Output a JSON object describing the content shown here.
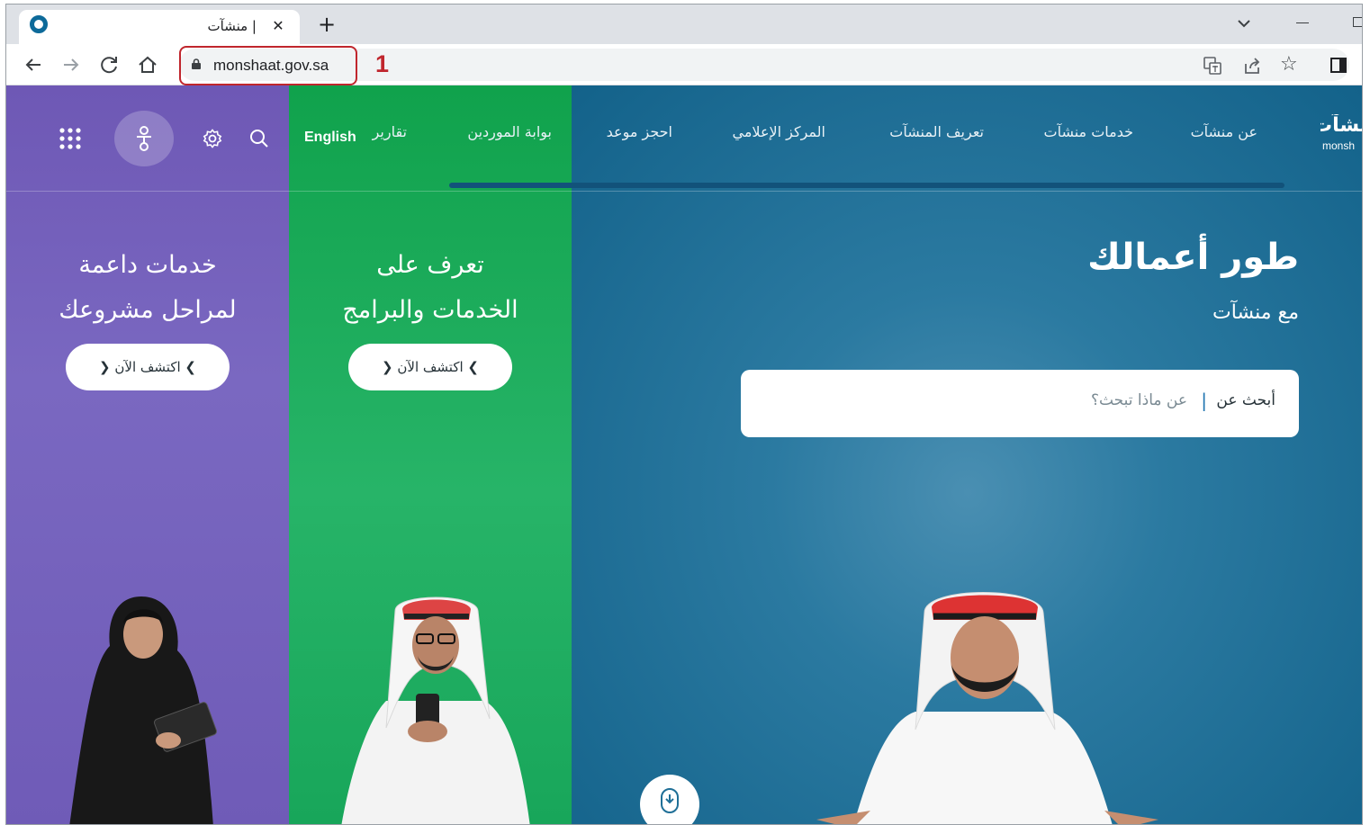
{
  "browser": {
    "tab_title": "| منشآت",
    "tab_close": "✕",
    "new_tab": "+",
    "url": "monshaat.gov.sa",
    "annotation_number": "1"
  },
  "nav": {
    "logo_text_ar": "نشآت",
    "logo_text_en": "monsh",
    "items": [
      "عن منشآت",
      "خدمات منشآت",
      "تعريف المنشآت",
      "المركز الإعلامي",
      "احجز موعد",
      "بوابة الموردين",
      "تقارير"
    ],
    "english": "English"
  },
  "panels": {
    "purple": {
      "title_line1": "خدمات داعمة",
      "title_line2": "لمراحل مشروعك",
      "cta": "اكتشف الآن",
      "color": "#6f5bb7"
    },
    "green": {
      "title_line1": "تعرف على",
      "title_line2": "الخدمات والبرامج",
      "cta": "اكتشف الآن",
      "color": "#18a65a"
    },
    "blue": {
      "title": "طور أعمالك",
      "subtitle": "مع منشآت",
      "search_label": "أبحث عن",
      "search_placeholder": "عن ماذا تبحث؟",
      "color": "#1f6f97"
    }
  },
  "icons": {
    "browser": [
      "app-logo",
      "close-icon",
      "plus-icon",
      "back-arrow-icon",
      "forward-arrow-icon",
      "reload-icon",
      "home-icon",
      "lock-icon",
      "translate-icon",
      "share-icon",
      "star-icon",
      "side-panel-icon",
      "chevron-down-icon",
      "minimize-icon",
      "restore-icon"
    ],
    "site": [
      "apps-grid-icon",
      "accessibility-icon",
      "settings-gear-icon",
      "search-icon",
      "chevron-right-icon",
      "chevron-left-icon",
      "mouse-scroll-icon"
    ]
  }
}
